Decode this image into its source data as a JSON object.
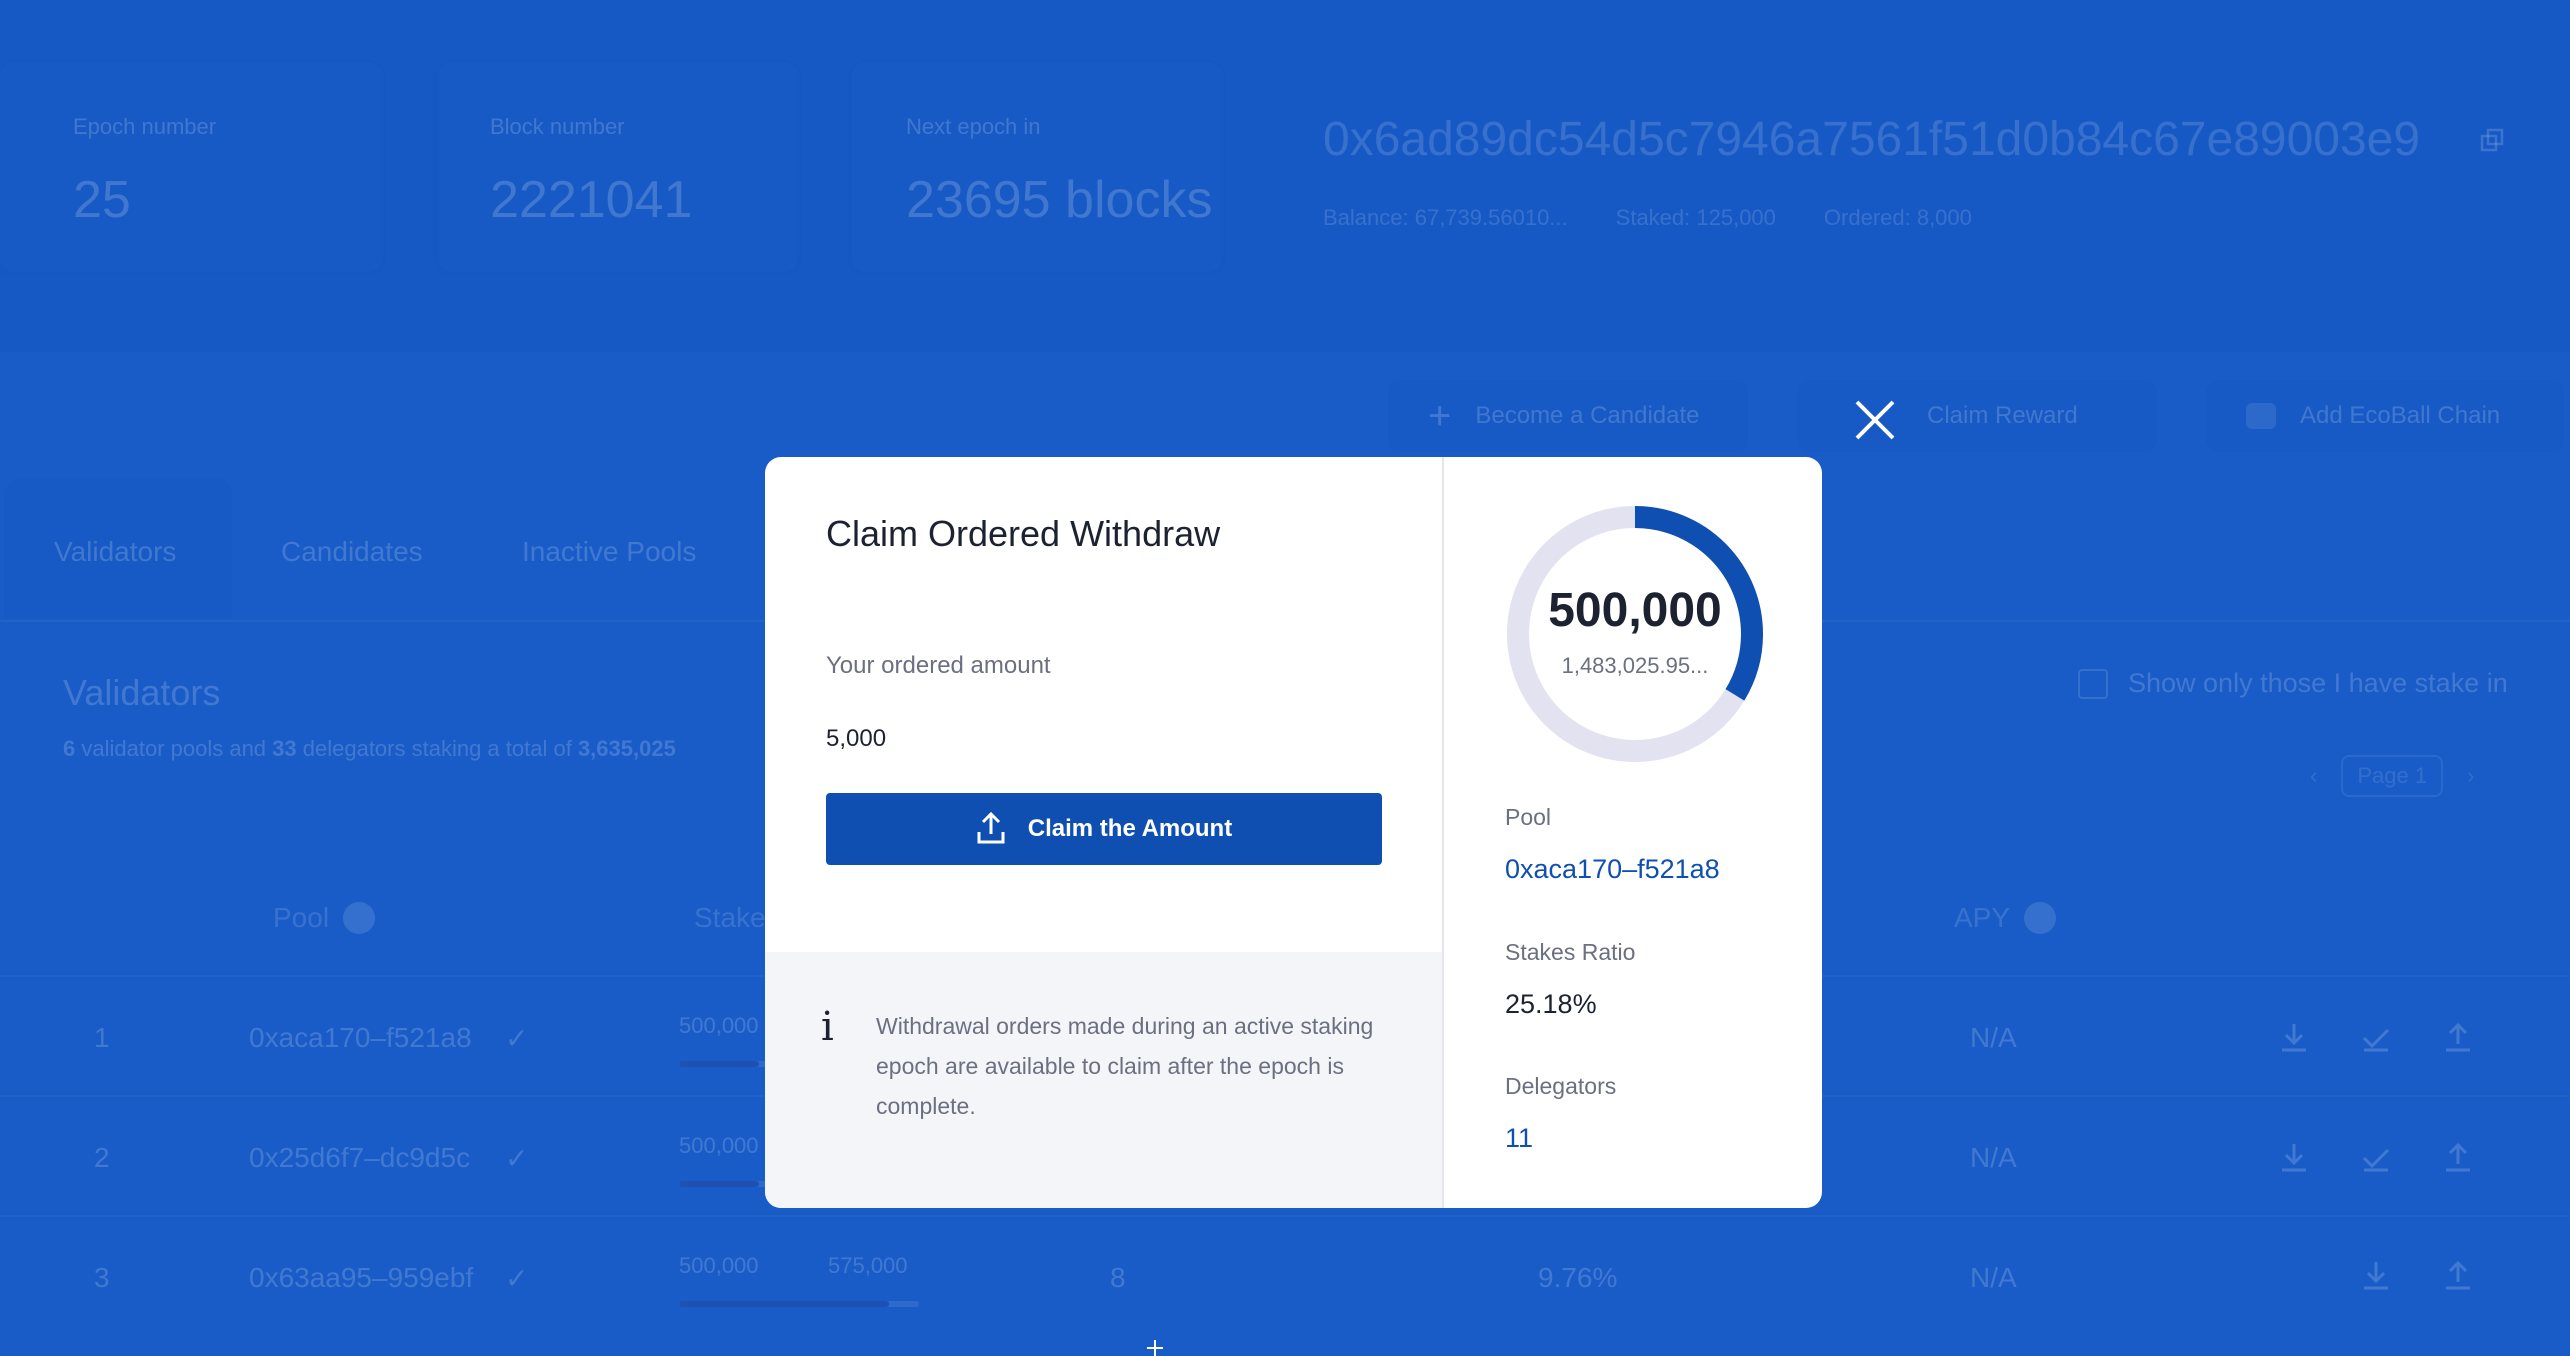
{
  "header": {
    "stats": [
      {
        "label": "Epoch number",
        "value": "25"
      },
      {
        "label": "Block number",
        "value": "2221041"
      },
      {
        "label": "Next epoch in",
        "value": "23695 blocks"
      }
    ],
    "address": "0x6ad89dc54d5c7946a7561f51d0b84c67e89003e9",
    "balance": "Balance: 67,739.56010...",
    "staked": "Staked: 125,000",
    "ordered": "Ordered: 8,000"
  },
  "actions": {
    "become_candidate": "Become a Candidate",
    "claim_reward": "Claim Reward",
    "add_chain": "Add EcoBall Chain"
  },
  "tabs": [
    "Validators",
    "Candidates",
    "Inactive Pools"
  ],
  "content": {
    "title": "Validators",
    "subtitle_pools": "6",
    "subtitle_text1": " validator pools and ",
    "subtitle_delegators": "33",
    "subtitle_text2": " delegators staking a total of ",
    "subtitle_total": "3,635,025",
    "show_only": "Show only those I have stake in",
    "page": "Page 1"
  },
  "table": {
    "headers": {
      "pool": "Pool",
      "stake": "Stake",
      "apy": "APY"
    },
    "rows": [
      {
        "index": "1",
        "pool": "0xaca170–f521a8",
        "stake": "500,000",
        "apy": "N/A",
        "delegators": "",
        "ratio": ""
      },
      {
        "index": "2",
        "pool": "0x25d6f7–dc9d5c",
        "stake": "500,000",
        "apy": "N/A",
        "delegators": "",
        "ratio": ""
      },
      {
        "index": "3",
        "pool": "0x63aa95–959ebf",
        "stake": "500,000",
        "stake_total": "575,000",
        "apy": "N/A",
        "delegators": "8",
        "ratio": "9.76%"
      }
    ]
  },
  "modal": {
    "title": "Claim Ordered Withdraw",
    "ordered_label": "Your ordered amount",
    "ordered_value": "5,000",
    "claim_button": "Claim the Amount",
    "info_icon": "i",
    "info_text": "Withdrawal orders made during an active staking epoch are available to claim after the epoch is complete.",
    "donut_value": "500,000",
    "donut_total": "1,483,025.95...",
    "donut_fraction": 0.337,
    "pool_label": "Pool",
    "pool_value": "0xaca170–f521a8",
    "ratio_label": "Stakes Ratio",
    "ratio_value": "25.18%",
    "delegators_label": "Delegators",
    "delegators_value": "11"
  },
  "colors": {
    "accent": "#0f4fb1",
    "background": "#1f63c6"
  }
}
